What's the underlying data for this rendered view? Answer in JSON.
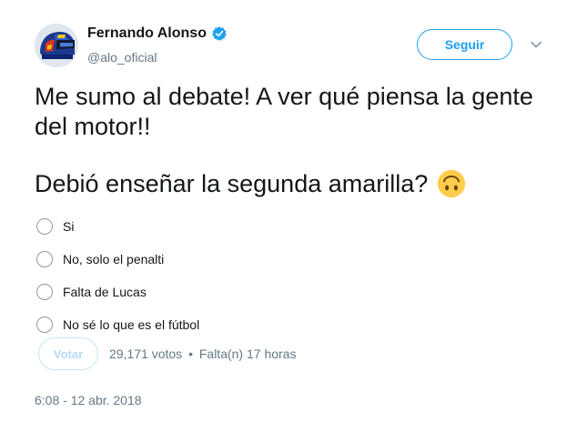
{
  "author": {
    "display_name": "Fernando Alonso",
    "handle": "@alo_oficial",
    "verified": true,
    "avatar_icon": "racing-helmet-avatar"
  },
  "actions": {
    "follow_label": "Seguir",
    "more_icon": "chevron-down-icon"
  },
  "tweet": {
    "text_line1": "Me sumo al debate! A ver qué piensa la gente",
    "text_line2": "del motor!!",
    "question": "Debió enseñar la segunda amarilla?",
    "question_emoji": "upside-down-face-emoji"
  },
  "poll": {
    "choices": [
      {
        "label": "Si"
      },
      {
        "label": "No, solo el penalti"
      },
      {
        "label": "Falta de Lucas"
      },
      {
        "label": "No sé lo que es el fútbol"
      }
    ],
    "vote_label": "Votar",
    "votes": "29,171 votos",
    "separator": "•",
    "time_left": "Falta(n) 17 horas"
  },
  "timestamp": "6:08 - 12 abr. 2018",
  "colors": {
    "accent": "#1da1f2",
    "text": "#14171a",
    "muted": "#657786",
    "vote_disabled": "#b4d9f3"
  }
}
